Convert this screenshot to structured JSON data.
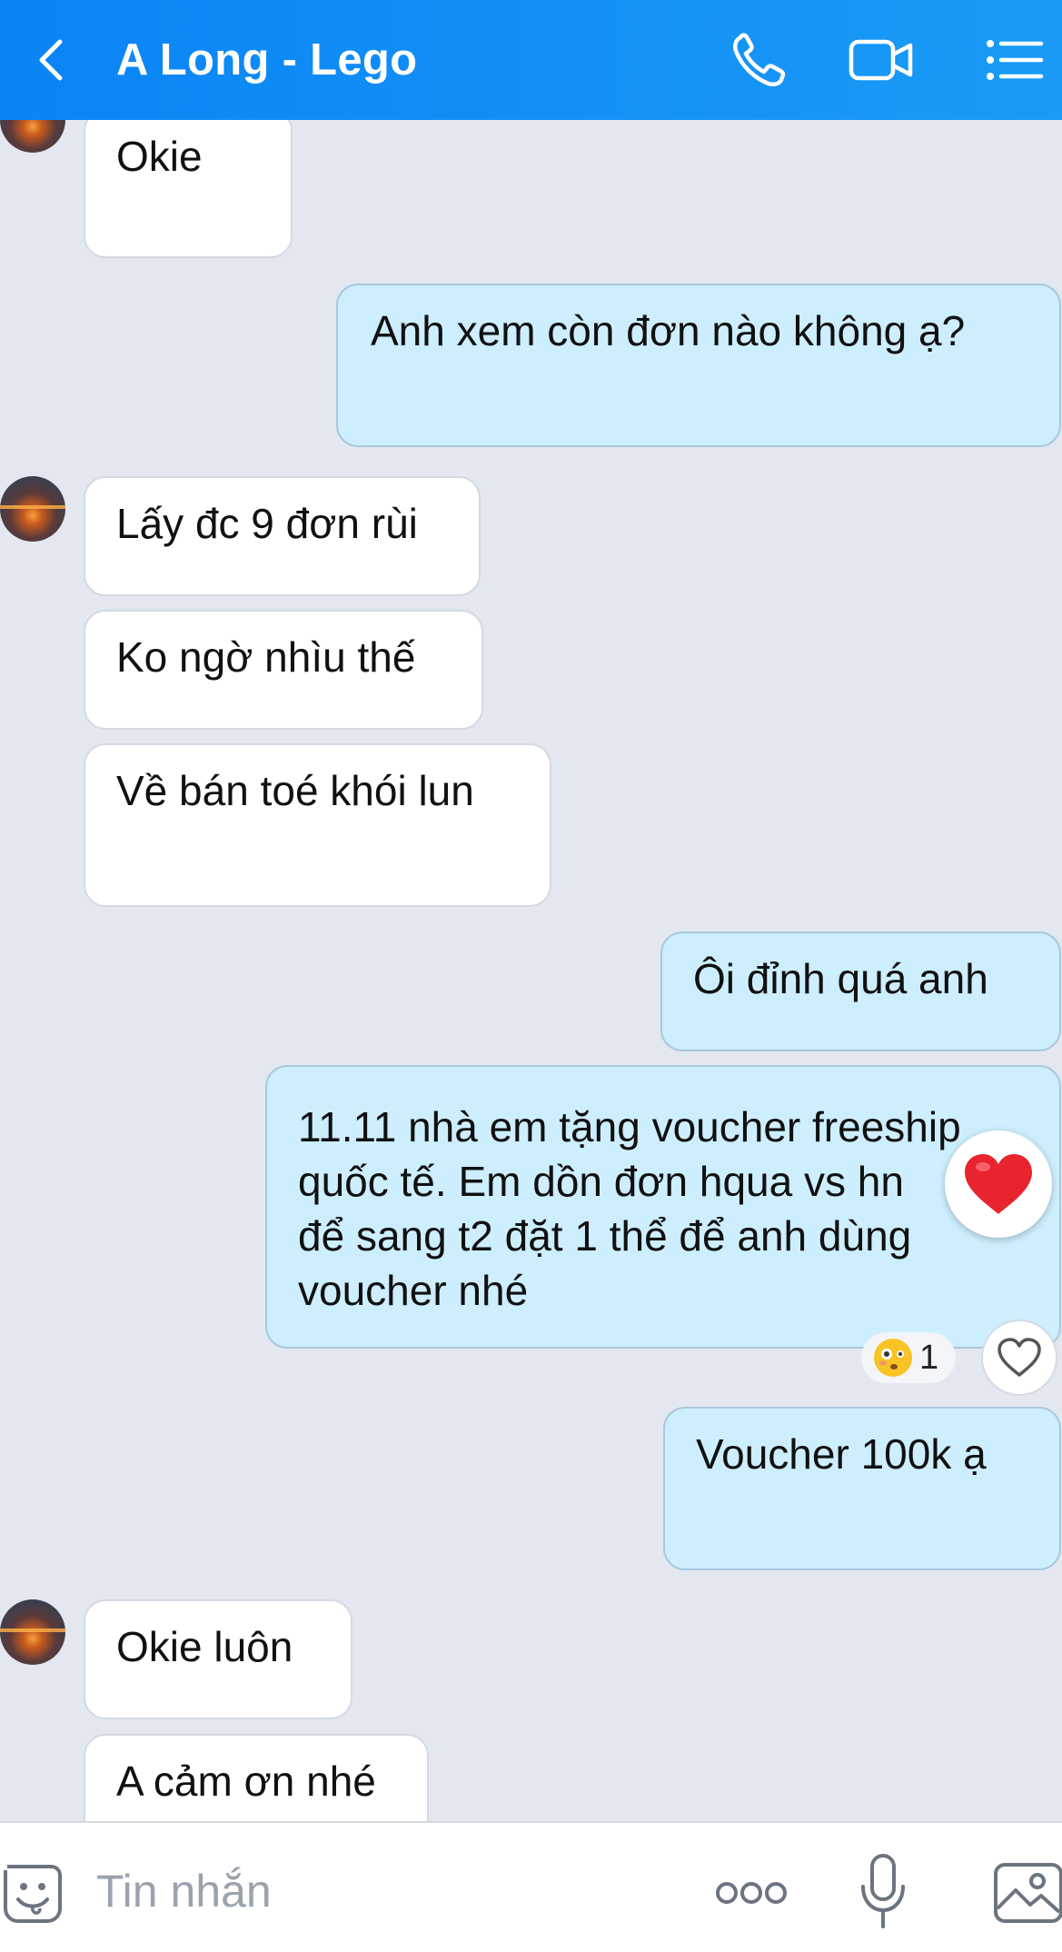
{
  "header": {
    "title": "A Long - Lego",
    "icons": [
      "back-arrow-icon",
      "phone-icon",
      "video-call-icon",
      "menu-list-icon"
    ]
  },
  "messages": [
    {
      "side": "in",
      "text": "Okie"
    },
    {
      "side": "out",
      "text": "Anh xem còn đơn nào không ạ?"
    },
    {
      "side": "in",
      "text": "Lấy đc 9 đơn rùi"
    },
    {
      "side": "in",
      "text": "Ko ngờ nhìu thế"
    },
    {
      "side": "in",
      "text": "Về bán toé khói lun"
    },
    {
      "side": "out",
      "text": "Ôi đỉnh quá anh"
    },
    {
      "side": "out",
      "lines": [
        "11.11 nhà em tặng voucher freeship",
        "quốc tế. Em dồn đơn hqua vs hn",
        "để sang t2 đặt 1 thể để anh dùng",
        "voucher nhé"
      ]
    },
    {
      "side": "out",
      "text": "Voucher 100k ạ"
    },
    {
      "side": "in",
      "text": "Okie luôn"
    },
    {
      "side": "in",
      "text": "A cảm ơn nhé"
    }
  ],
  "reactions": {
    "heart": "heart-reaction-icon",
    "count": "1",
    "like": "heart-outline-icon"
  },
  "input": {
    "placeholder": "Tin nhắn",
    "icons": [
      "sticker-icon",
      "more-icon",
      "mic-icon",
      "image-icon"
    ]
  }
}
